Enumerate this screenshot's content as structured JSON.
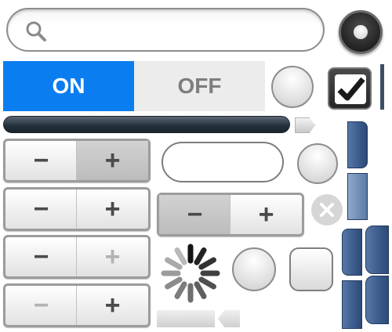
{
  "search": {
    "placeholder": "",
    "value": "",
    "icon": "search-icon"
  },
  "radio_dark": {
    "selected": true
  },
  "switch": {
    "on_label": "ON",
    "off_label": "OFF",
    "state": "on",
    "accent": "#0a7df0"
  },
  "checkbox": {
    "checked": true,
    "icon": "checkmark-icon"
  },
  "progress": {
    "fill_color": "#23303c"
  },
  "steppers": [
    {
      "minus_label": "−",
      "plus_label": "+",
      "pressed": "plus",
      "disabled": ""
    },
    {
      "minus_label": "−",
      "plus_label": "+",
      "pressed": "",
      "disabled": ""
    },
    {
      "minus_label": "−",
      "plus_label": "+",
      "pressed": "",
      "disabled": "plus"
    },
    {
      "minus_label": "−",
      "plus_label": "+",
      "pressed": "",
      "disabled": "minus"
    },
    {
      "minus_label": "−",
      "plus_label": "+",
      "pressed": "minus",
      "disabled": ""
    }
  ],
  "text_field": {
    "value": "",
    "placeholder": ""
  },
  "clear_button": {
    "icon": "close-icon"
  },
  "spinner": {
    "icon": "activity-spinner-icon"
  },
  "tab_color": "#3b5b8c"
}
